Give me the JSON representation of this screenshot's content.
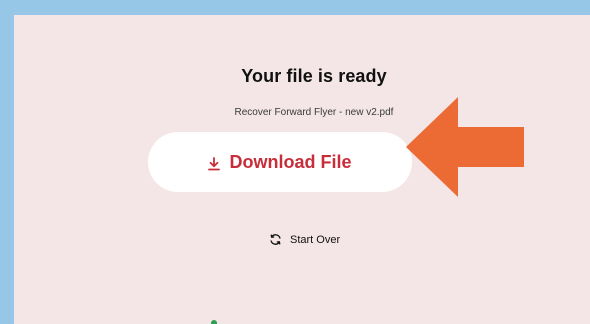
{
  "page": {
    "title": "Your file is ready",
    "filename": "Recover Forward Flyer - new v2.pdf"
  },
  "download": {
    "label": "Download File",
    "icon": "download-icon"
  },
  "start_over": {
    "label": "Start Over",
    "icon": "refresh-icon"
  },
  "annotation": {
    "icon": "arrow-left-icon",
    "color": "#ec6a33"
  },
  "colors": {
    "frame": "#96c7e6",
    "panel": "#f4e6e6",
    "accent": "#c72e3a"
  }
}
